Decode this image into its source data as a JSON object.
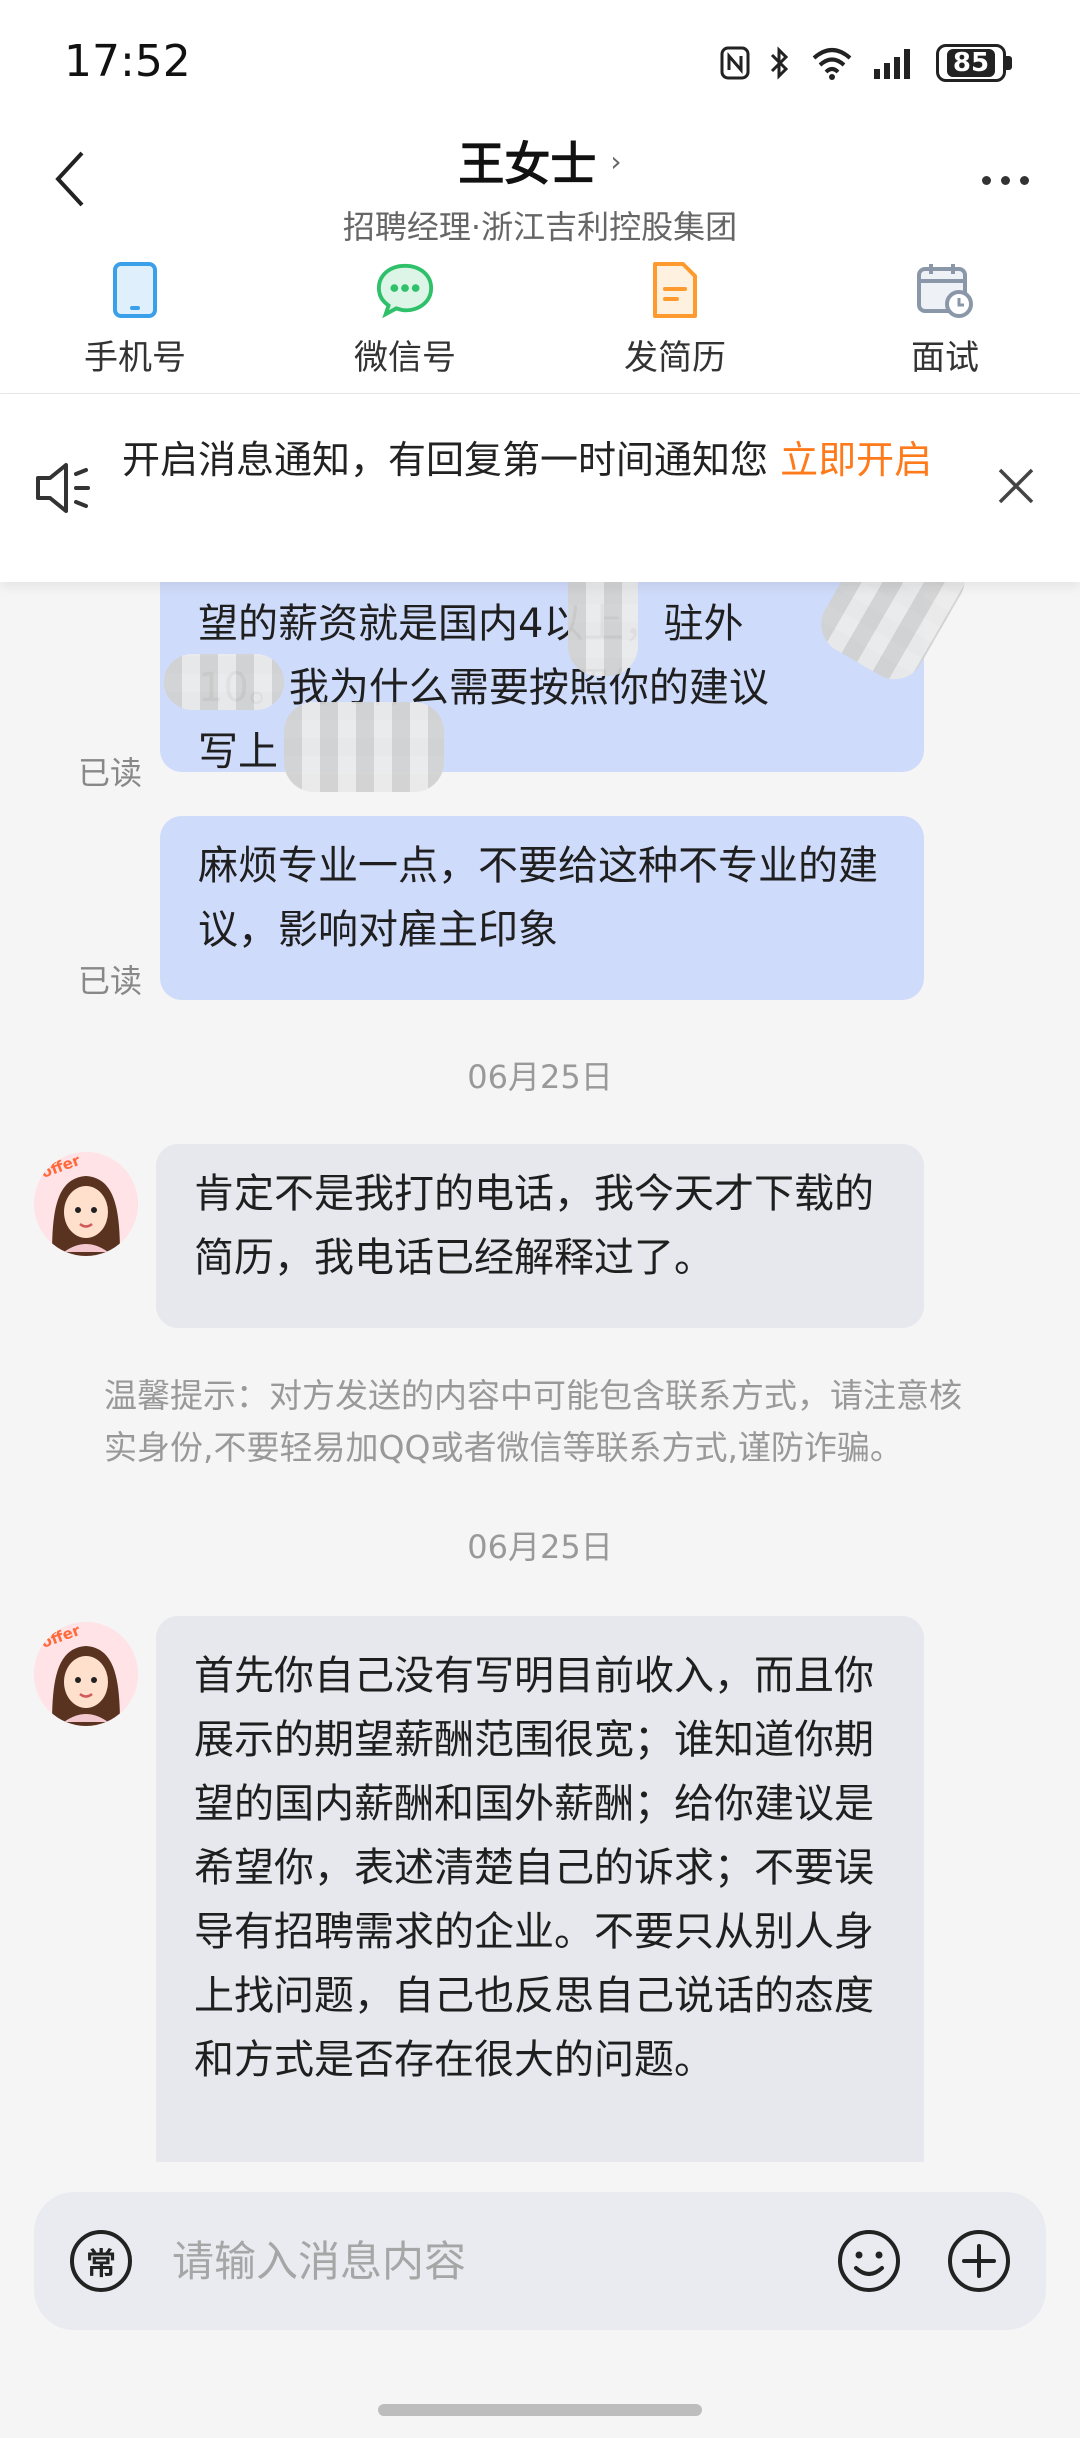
{
  "status_bar": {
    "time": "17:52",
    "battery": "85"
  },
  "header": {
    "name": "王女士",
    "subtitle": "招聘经理·浙江吉利控股集团"
  },
  "actions": [
    {
      "label": "手机号",
      "icon": "phone-icon",
      "color": "#3aa0ea"
    },
    {
      "label": "微信号",
      "icon": "wechat-icon",
      "color": "#2fc16a"
    },
    {
      "label": "发简历",
      "icon": "resume-icon",
      "color": "#ff9a2e"
    },
    {
      "label": "面试",
      "icon": "calendar-icon",
      "color": "#8a97a8"
    }
  ],
  "notice": {
    "text": "开启消息通知，有回复第一时间通知您 ",
    "link": "立即开启"
  },
  "messages": {
    "msg1_lines": [
      "望的薪资就是国内4以上，驻外",
      "10。我为什么需要按照你的建议",
      "写上"
    ],
    "msg1_read": "已读",
    "msg2": "麻烦专业一点，不要给这种不专业的建议，影响对雇主印象",
    "msg2_read": "已读",
    "date1": "06月25日",
    "msg3": "肯定不是我打的电话，我今天才下载的简历，我电话已经解释过了。",
    "tip": "温馨提示：对方发送的内容中可能包含联系方式，请注意核实身份,不要轻易加QQ或者微信等联系方式,谨防诈骗。",
    "date2": "06月25日",
    "msg4": "首先你自己没有写明目前收入，而且你展示的期望薪酬范围很宽；谁知道你期望的国内薪酬和国外薪酬；给你建议是希望你，表述清楚自己的诉求；不要误导有招聘需求的企业。不要只从别人身上找问题，自己也反思自己说话的态度和方式是否存在很大的问题。",
    "avatar_label": "offer大手"
  },
  "input": {
    "chang": "常",
    "placeholder": "请输入消息内容",
    "value": ""
  },
  "colors": {
    "accent": "#ff7a1a",
    "my_bubble": "#cfdbfa",
    "their_bubble": "#e6e8ee"
  }
}
